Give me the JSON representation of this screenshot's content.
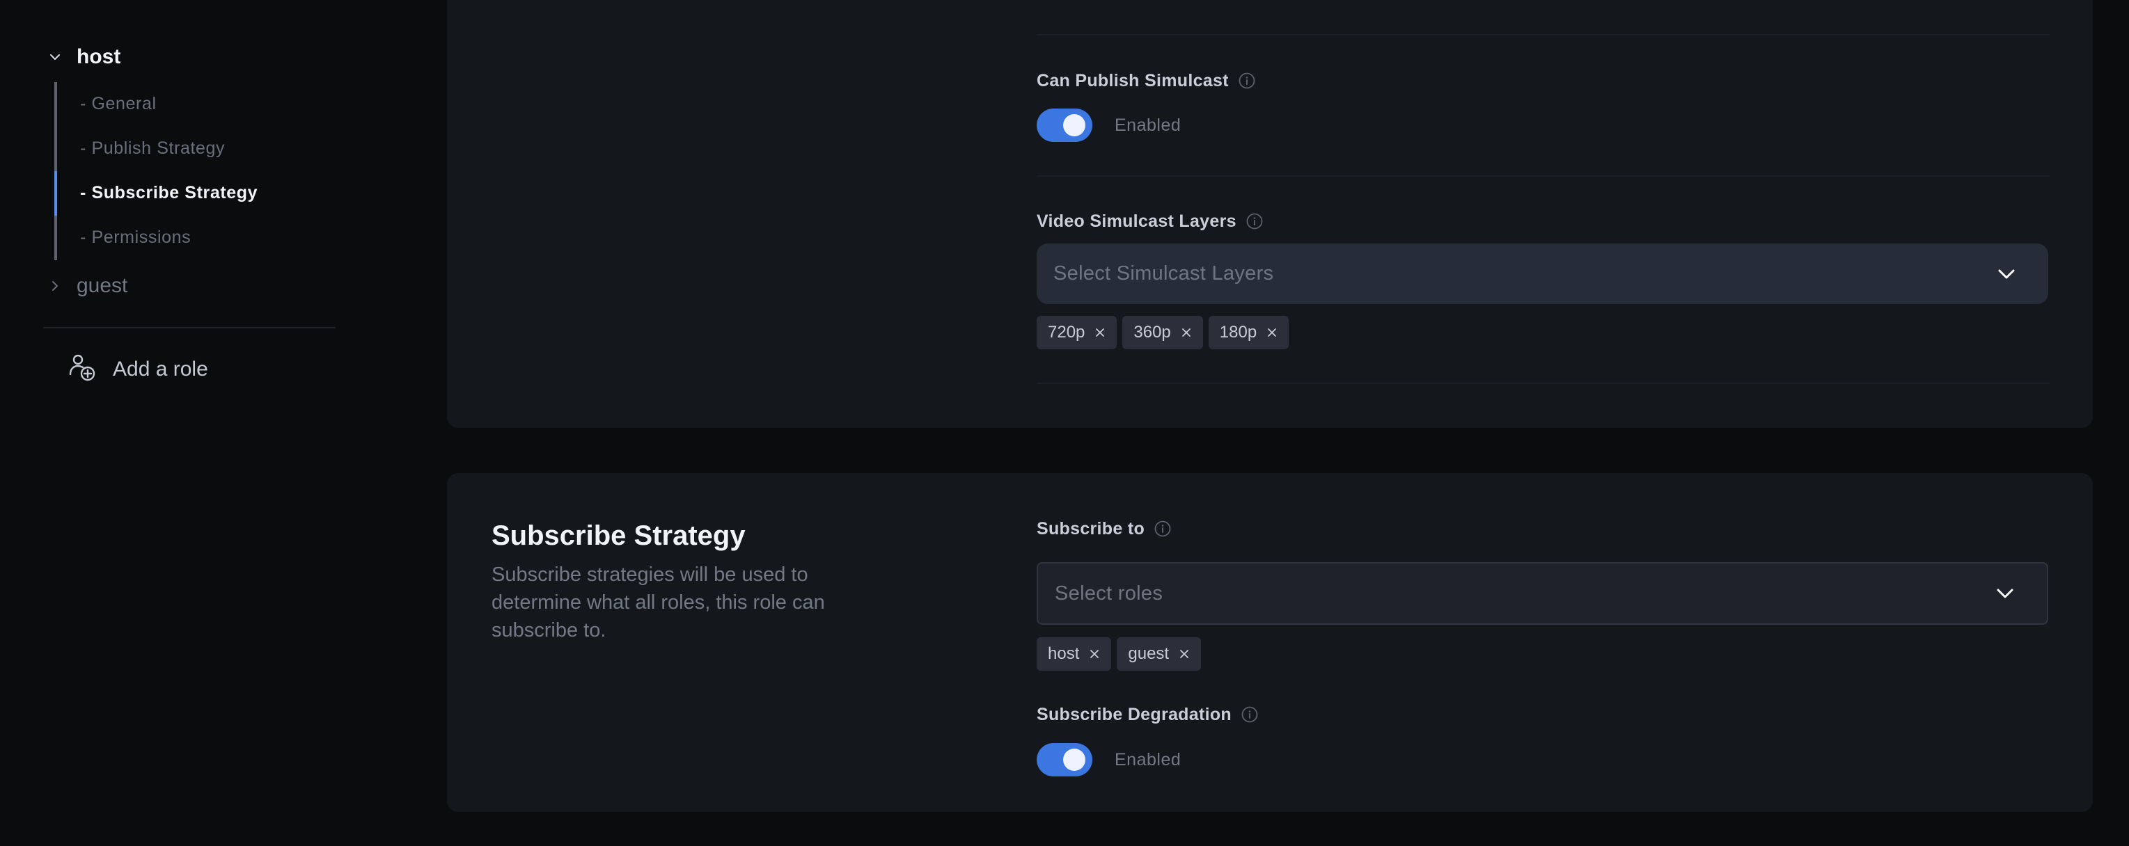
{
  "sidebar": {
    "roles": [
      {
        "name": "host",
        "expanded": true,
        "items": [
          {
            "label": "- General",
            "active": false
          },
          {
            "label": "- Publish Strategy",
            "active": false
          },
          {
            "label": "- Subscribe Strategy",
            "active": true
          },
          {
            "label": "- Permissions",
            "active": false
          }
        ]
      },
      {
        "name": "guest",
        "expanded": false
      }
    ],
    "add_role_label": "Add a role"
  },
  "publish_section": {
    "can_publish_simulcast": {
      "label": "Can Publish Simulcast",
      "enabled": true,
      "state_text": "Enabled"
    },
    "video_simulcast_layers": {
      "label": "Video Simulcast Layers",
      "placeholder": "Select Simulcast Layers",
      "selected": [
        "720p",
        "360p",
        "180p"
      ]
    }
  },
  "subscribe_section": {
    "title": "Subscribe Strategy",
    "description": "Subscribe strategies will be used to determine what all roles, this role can subscribe to.",
    "subscribe_to": {
      "label": "Subscribe to",
      "placeholder": "Select roles",
      "selected": [
        "host",
        "guest"
      ]
    },
    "subscribe_degradation": {
      "label": "Subscribe Degradation",
      "enabled": true,
      "state_text": "Enabled"
    }
  },
  "colors": {
    "accent": "#3b76e1",
    "active_indicator": "#5a8dee",
    "page_bg": "#0b0c0e",
    "panel_bg": "#14171c"
  }
}
